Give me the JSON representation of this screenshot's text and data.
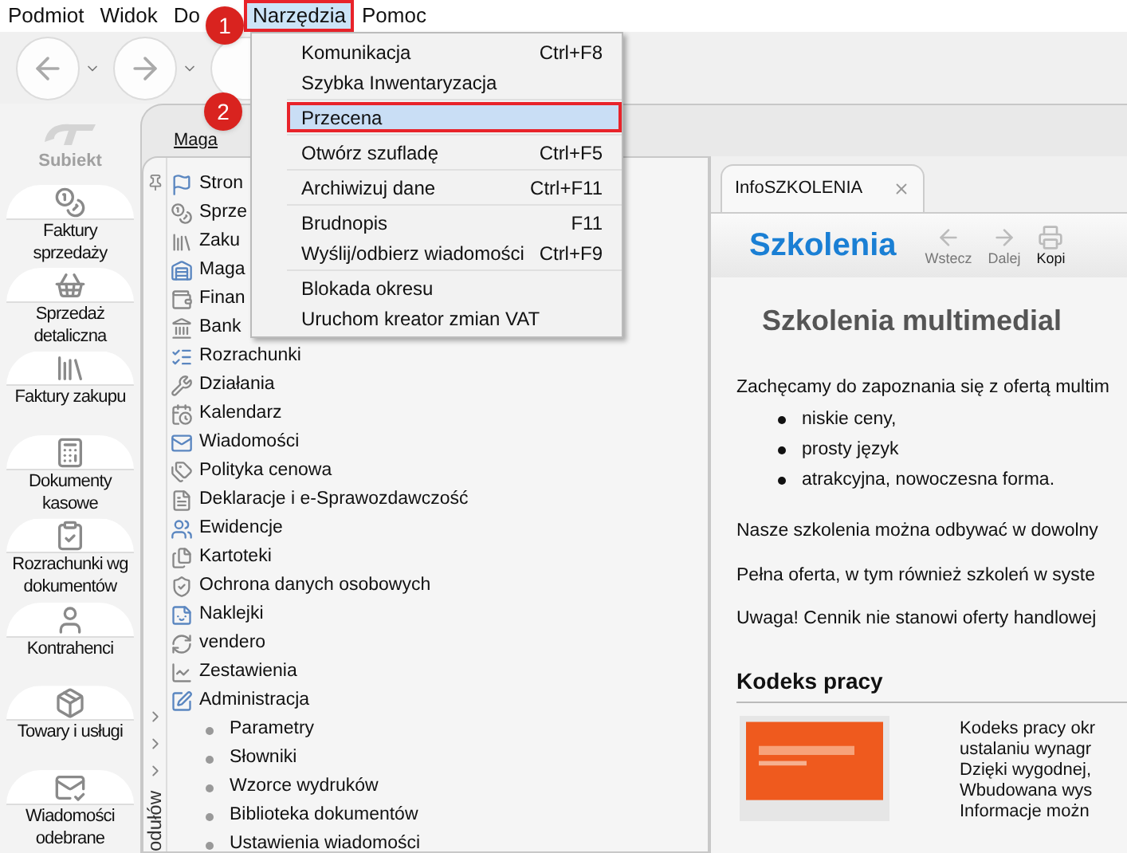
{
  "menubar": [
    {
      "label": "Podmiot",
      "selected": false
    },
    {
      "label": "Widok",
      "selected": false
    },
    {
      "label": "Do",
      "selected": false
    },
    {
      "label": "Narzędzia",
      "selected": true
    },
    {
      "label": "Pomoc",
      "selected": false
    }
  ],
  "step_badges": [
    "1",
    "2"
  ],
  "menu": {
    "groups": [
      [
        {
          "label": "Komunikacja",
          "shortcut": "Ctrl+F8",
          "selected": false
        },
        {
          "label": "Szybka Inwentaryzacja",
          "selected": false
        }
      ],
      [
        {
          "label": "Przecena",
          "selected": true
        }
      ],
      [
        {
          "label": "Otwórz szufladę",
          "shortcut": "Ctrl+F5",
          "selected": false
        }
      ],
      [
        {
          "label": "Archiwizuj dane",
          "shortcut": "Ctrl+F11",
          "selected": false
        }
      ],
      [
        {
          "label": "Brudnopis",
          "shortcut": "F11",
          "selected": false
        },
        {
          "label": "Wyślij/odbierz wiadomości",
          "shortcut": "Ctrl+F9",
          "selected": false
        }
      ],
      [
        {
          "label": "Blokada okresu",
          "selected": false
        },
        {
          "label": "Uruchom kreator zmian VAT",
          "selected": false
        }
      ]
    ]
  },
  "logo": "Subiekt",
  "sidebar": [
    {
      "label": "Faktury\nsprzedaży"
    },
    {
      "label": "Sprzedaż\ndetaliczna"
    },
    {
      "label": "Faktury zakupu"
    },
    {
      "label": "Dokumenty\nkasowe"
    },
    {
      "label": "Rozrachunki wg\ndokumentów"
    },
    {
      "label": "Kontrahenci"
    },
    {
      "label": "Towary i usługi"
    },
    {
      "label": "Wiadomości\nodebrane"
    }
  ],
  "tree_tab": "Maga",
  "side_label": "odułów",
  "tree": [
    {
      "label": "Stron"
    },
    {
      "label": "Sprze"
    },
    {
      "label": "Zaku"
    },
    {
      "label": "Maga"
    },
    {
      "label": "Finan"
    },
    {
      "label": "Bank"
    },
    {
      "label": "Rozrachunki"
    },
    {
      "label": "Działania"
    },
    {
      "label": "Kalendarz"
    },
    {
      "label": "Wiadomości"
    },
    {
      "label": "Polityka cenowa"
    },
    {
      "label": "Deklaracje i e-Sprawozdawczość"
    },
    {
      "label": "Ewidencje"
    },
    {
      "label": "Kartoteki"
    },
    {
      "label": "Ochrona danych osobowych"
    },
    {
      "label": "Naklejki"
    },
    {
      "label": "vendero"
    },
    {
      "label": "Zestawienia"
    },
    {
      "label": "Administracja",
      "children": [
        {
          "label": "Parametry"
        },
        {
          "label": "Słowniki"
        },
        {
          "label": "Wzorce wydruków"
        },
        {
          "label": "Biblioteka dokumentów"
        },
        {
          "label": "Ustawienia wiadomości"
        }
      ]
    }
  ],
  "info_tab": {
    "label": "InfoSZKOLENIA"
  },
  "info_header": {
    "title": "Szkolenia",
    "nav": [
      "Wstecz",
      "Dalej",
      "Kopi"
    ]
  },
  "article": {
    "heading": "Szkolenia multimedial",
    "intro": "Zachęcamy do zapoznania się z ofertą multim",
    "bullets": [
      "niskie ceny,",
      "prosty język",
      "atrakcyjna, nowoczesna forma."
    ],
    "paragraphs": [
      "Nasze szkolenia można odbywać w dowolny",
      "Pełna oferta, w tym również szkoleń w syste",
      "Uwaga! Cennik nie stanowi oferty handlowej"
    ],
    "section": {
      "title": "Kodeks pracy",
      "lines": [
        "Kodeks pracy okr",
        "ustalaniu wynagr",
        "Dzięki wygodnej,",
        "Wbudowana wys",
        "Informacje możn"
      ]
    }
  }
}
